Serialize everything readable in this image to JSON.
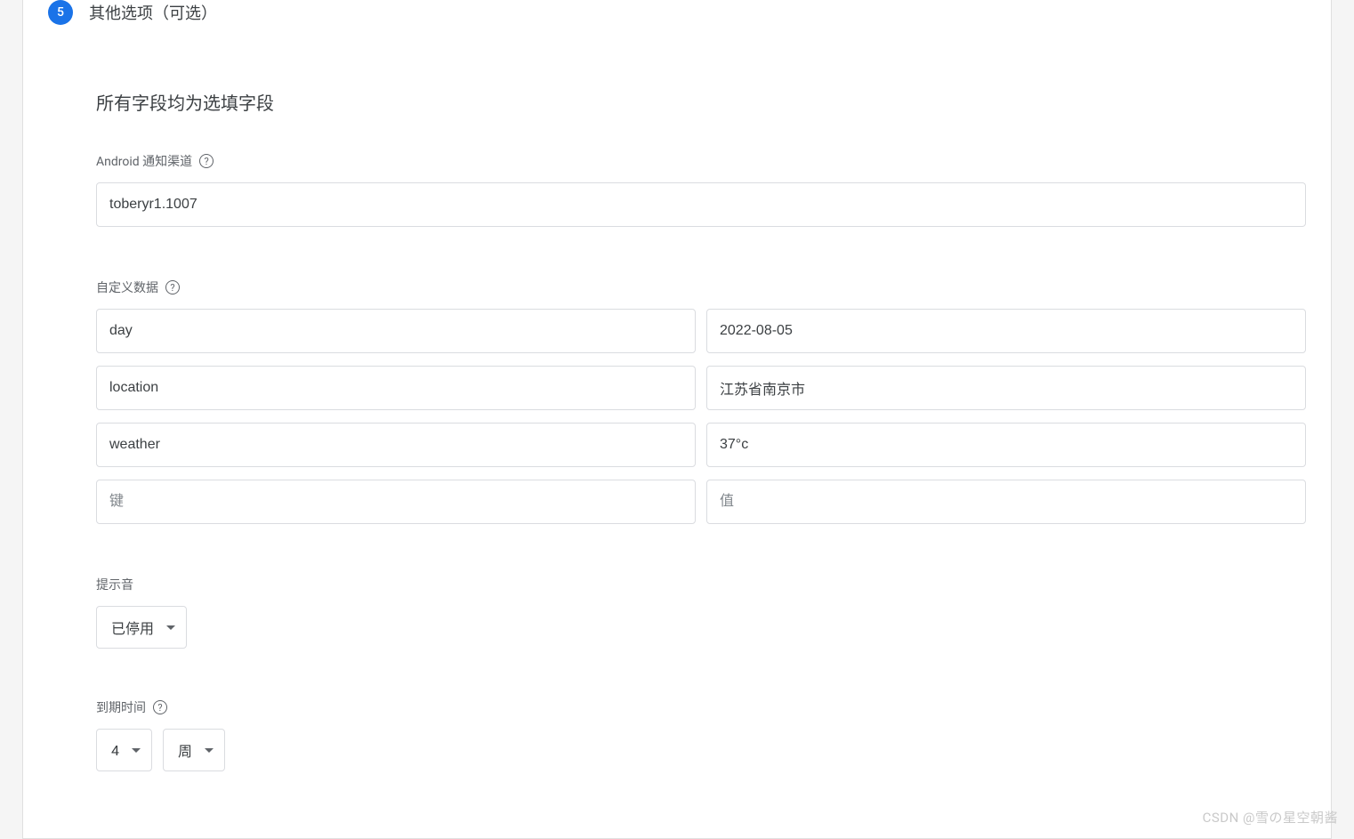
{
  "step": {
    "number": "5",
    "title": "其他选项（可选）"
  },
  "heading": "所有字段均为选填字段",
  "androidChannel": {
    "label": "Android 通知渠道",
    "value": "toberyr1.1007"
  },
  "customData": {
    "label": "自定义数据",
    "rows": [
      {
        "key": "day",
        "value": "2022-08-05"
      },
      {
        "key": "location",
        "value": "江苏省南京市"
      },
      {
        "key": "weather",
        "value": "37°c"
      }
    ],
    "emptyRow": {
      "keyPlaceholder": "键",
      "valuePlaceholder": "值"
    }
  },
  "sound": {
    "label": "提示音",
    "value": "已停用"
  },
  "expiry": {
    "label": "到期时间",
    "amount": "4",
    "unit": "周"
  },
  "watermark": "CSDN @雪の星空朝酱"
}
